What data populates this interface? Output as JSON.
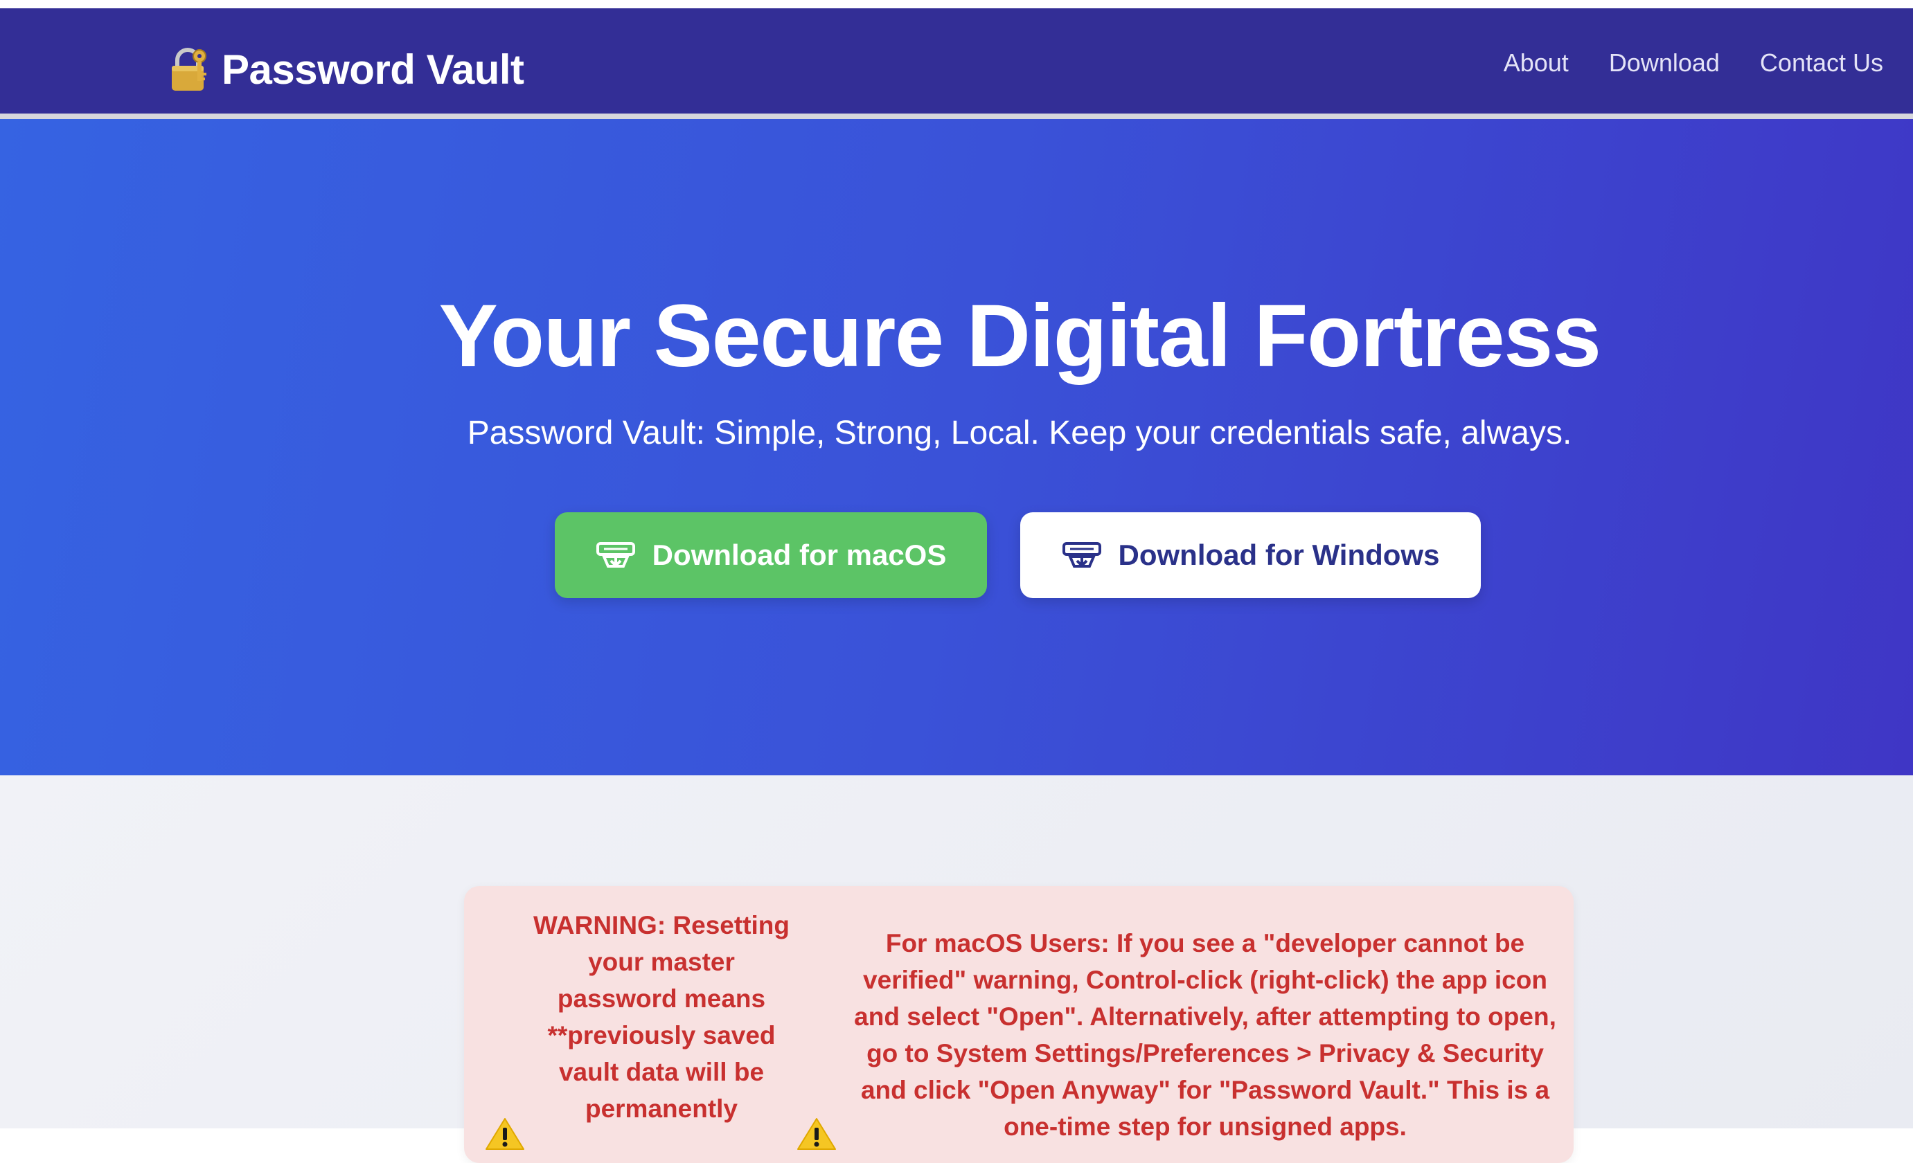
{
  "navbar": {
    "brand_icon": "lock-with-key-icon",
    "brand_name": "Password Vault",
    "links": [
      "About",
      "Download",
      "Contact Us"
    ]
  },
  "hero": {
    "title": "Your Secure Digital Fortress",
    "subtitle": "Password Vault: Simple, Strong, Local. Keep your credentials safe, always.",
    "buttons": {
      "macos": {
        "label": "Download for macOS",
        "icon": "download-icon",
        "color": "#5cc466"
      },
      "windows": {
        "label": "Download for Windows",
        "icon": "download-icon",
        "color": "#ffffff"
      }
    }
  },
  "warning": {
    "icon": "warning-icon",
    "text_reset": "WARNING: Resetting your master password means **previously saved vault data will be permanently",
    "text_macos": "For macOS Users: If you see a \"developer cannot be verified\" warning, Control-click (right-click) the app icon and select \"Open\". Alternatively, after attempting to open, go to System Settings/Preferences > Privacy & Security and click \"Open Anyway\" for \"Password Vault.\" This is a one-time step for unsigned apps."
  },
  "colors": {
    "navbar": "#332e96",
    "hero_start": "#3663e2",
    "hero_end": "#3f36c5",
    "warning_bg": "#f8e1e1",
    "warning_text": "#c8302f"
  }
}
